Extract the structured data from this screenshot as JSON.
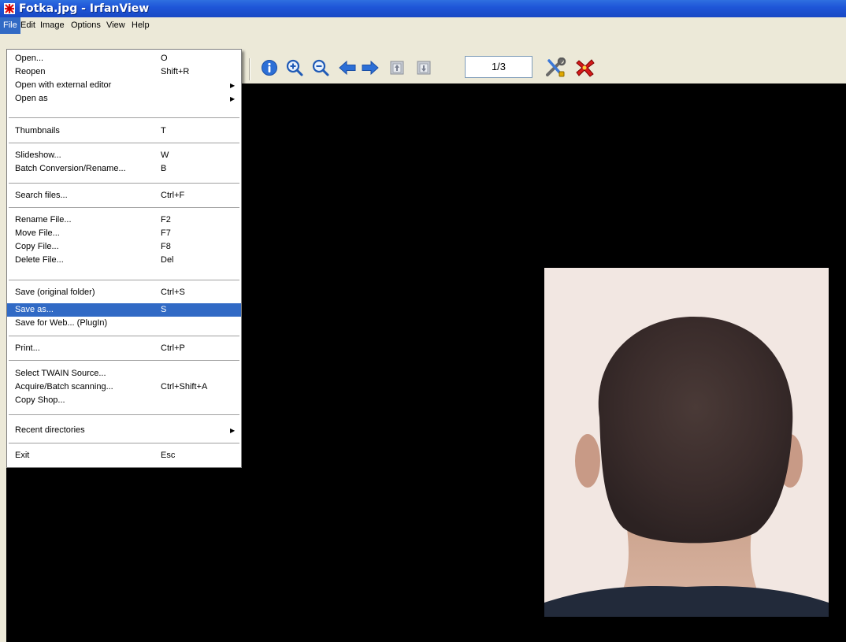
{
  "window": {
    "title": "Fotka.jpg - IrfanView"
  },
  "menubar": {
    "items": [
      "File",
      "Edit",
      "Image",
      "Options",
      "View",
      "Help"
    ]
  },
  "toolbar": {
    "icons": [
      "info-icon",
      "zoom-in-icon",
      "zoom-out-icon",
      "previous-icon",
      "next-icon",
      "first-page-icon",
      "last-page-icon",
      "settings-icon",
      "exit-icon"
    ],
    "page_indicator": "1/3"
  },
  "file_menu": {
    "items": [
      {
        "label": "Open...",
        "shortcut": "O"
      },
      {
        "label": "Reopen",
        "shortcut": "Shift+R"
      },
      {
        "label": "Open with external editor",
        "shortcut": ""
      },
      {
        "label": "Open as",
        "shortcut": ""
      },
      {
        "label": "Thumbnails",
        "shortcut": "T"
      },
      {
        "label": "Slideshow...",
        "shortcut": "W"
      },
      {
        "label": "Batch Conversion/Rename...",
        "shortcut": "B"
      },
      {
        "label": "Search files...",
        "shortcut": "Ctrl+F"
      },
      {
        "label": "Rename File...",
        "shortcut": "F2"
      },
      {
        "label": "Move File...",
        "shortcut": "F7"
      },
      {
        "label": "Copy File...",
        "shortcut": "F8"
      },
      {
        "label": "Delete File...",
        "shortcut": "Del"
      },
      {
        "label": "Save (original folder)",
        "shortcut": "Ctrl+S"
      },
      {
        "label": "Save as...",
        "shortcut": "S"
      },
      {
        "label": "Save for Web... (PlugIn)",
        "shortcut": ""
      },
      {
        "label": "Print...",
        "shortcut": "Ctrl+P"
      },
      {
        "label": "Select TWAIN Source...",
        "shortcut": ""
      },
      {
        "label": "Acquire/Batch scanning...",
        "shortcut": "Ctrl+Shift+A"
      },
      {
        "label": "Copy Shop...",
        "shortcut": ""
      },
      {
        "label": "Recent directories",
        "shortcut": ""
      },
      {
        "label": "Exit",
        "shortcut": "Esc"
      }
    ],
    "highlighted": "Save as..."
  },
  "colors": {
    "titlebar": "#1f56d8",
    "menu_highlight": "#316ac5",
    "chrome": "#ece9d8",
    "viewer_background": "#000000"
  }
}
